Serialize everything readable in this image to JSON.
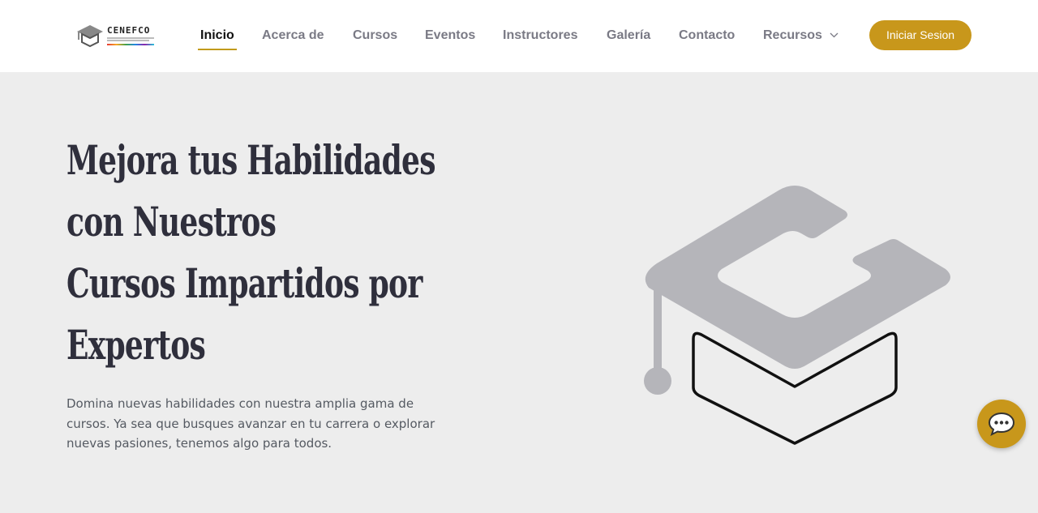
{
  "header": {
    "logo_text": "CENEFCO",
    "nav": [
      {
        "label": "Inicio",
        "active": true
      },
      {
        "label": "Acerca de"
      },
      {
        "label": "Cursos"
      },
      {
        "label": "Eventos"
      },
      {
        "label": "Instructores"
      },
      {
        "label": "Galería"
      },
      {
        "label": "Contacto"
      },
      {
        "label": "Recursos",
        "icon": "chevron-down-icon"
      }
    ],
    "login_label": "Iniciar Sesion"
  },
  "hero": {
    "title_lines": [
      "Mejora tus Habilidades",
      "con Nuestros",
      "Cursos Impartidos por",
      "Expertos"
    ],
    "description": "Domina nuevas habilidades con nuestra amplia gama de cursos. Ya sea que busques avanzar en tu carrera o explorar nuevas pasiones, tenemos algo para todos.",
    "illustration_icon": "graduation-cap-icon"
  },
  "chat": {
    "icon": "chat-bubble-icon"
  },
  "colors": {
    "accent": "#c8971b",
    "background": "#ededed",
    "header_bg": "#ffffff",
    "title": "#2f2f3c",
    "cap_gray": "#b5b5ba"
  }
}
